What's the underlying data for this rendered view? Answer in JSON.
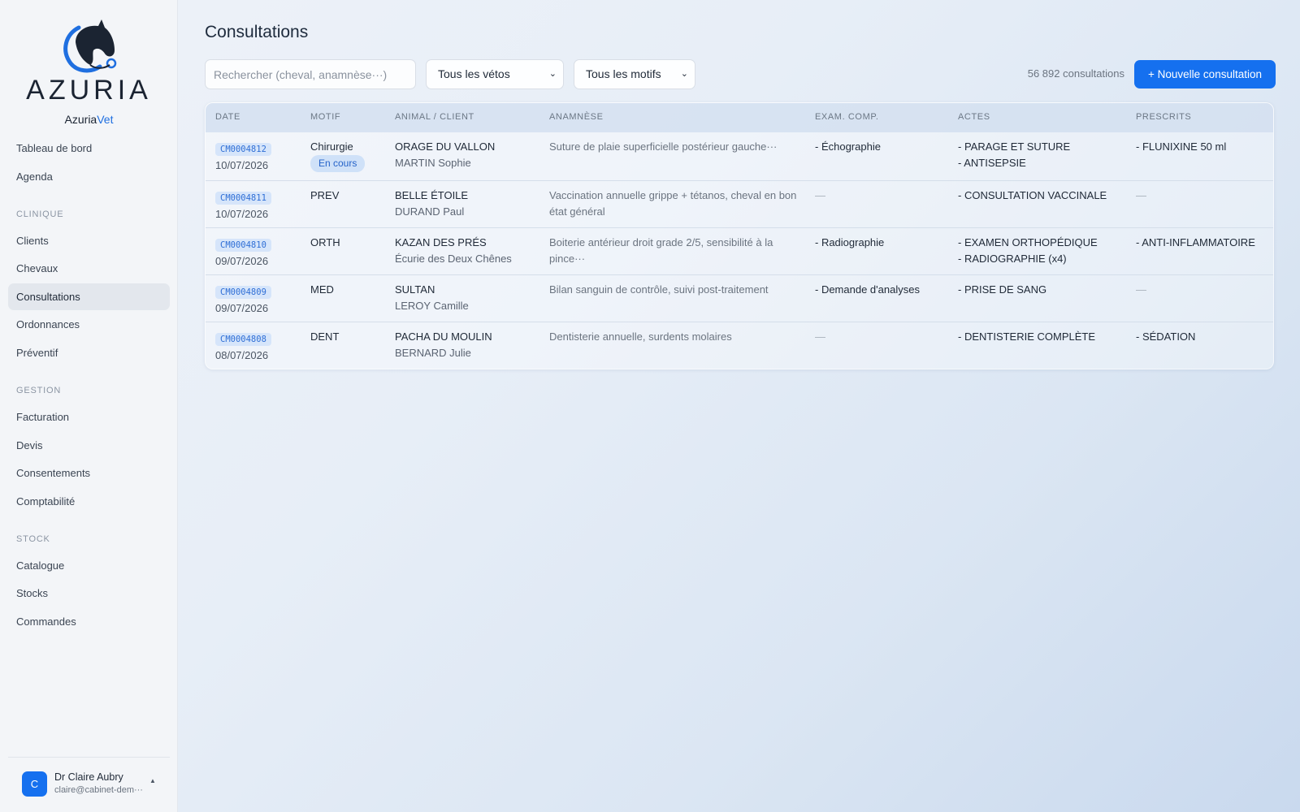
{
  "brand": {
    "wordmark": "AZURIA",
    "sub_main": "Azuria",
    "sub_accent": "Vet"
  },
  "nav": {
    "top": [
      "Tableau de bord",
      "Agenda"
    ],
    "sections": [
      {
        "title": "CLINIQUE",
        "items": [
          "Clients",
          "Chevaux",
          "Consultations",
          "Ordonnances",
          "Préventif"
        ]
      },
      {
        "title": "GESTION",
        "items": [
          "Facturation",
          "Devis",
          "Consentements",
          "Comptabilité"
        ]
      },
      {
        "title": "STOCK",
        "items": [
          "Catalogue",
          "Stocks",
          "Commandes"
        ]
      }
    ],
    "active": "Consultations"
  },
  "user": {
    "initial": "C",
    "name": "Dr Claire Aubry",
    "email": "claire@cabinet-dem···",
    "caret": "▲"
  },
  "page": {
    "title": "Consultations",
    "search_placeholder": "Rechercher (cheval, anamnèse···)",
    "vet_filter": "Tous les vétos",
    "motif_filter": "Tous les motifs",
    "count": "56 892 consultations",
    "new_button": "+ Nouvelle consultation"
  },
  "table": {
    "headers": [
      "DATE",
      "MOTIF",
      "ANIMAL / CLIENT",
      "ANAMNÈSE",
      "EXAM. COMP.",
      "ACTES",
      "PRESCRITS"
    ],
    "rows": [
      {
        "id": "CM0004812",
        "date": "10/07/2026",
        "motif": "Chirurgie",
        "status": "En cours",
        "animal": "ORAGE DU VALLON",
        "client": "MARTIN Sophie",
        "anamnese": "Suture de plaie superficielle postérieur gauche···",
        "exam": "- Échographie",
        "actes": [
          "- PARAGE ET SUTURE",
          "- ANTISEPSIE"
        ],
        "prescrits": "- FLUNIXINE 50 ml"
      },
      {
        "id": "CM0004811",
        "date": "10/07/2026",
        "motif": "PREV",
        "status": "",
        "animal": "BELLE ÉTOILE",
        "client": "DURAND Paul",
        "anamnese": "Vaccination annuelle grippe + tétanos, cheval en bon état général",
        "exam": "—",
        "actes": [
          "- CONSULTATION VACCINALE"
        ],
        "prescrits": "—"
      },
      {
        "id": "CM0004810",
        "date": "09/07/2026",
        "motif": "ORTH",
        "status": "",
        "animal": "KAZAN DES PRÉS",
        "client": "Écurie des Deux Chênes",
        "anamnese": "Boiterie antérieur droit grade 2/5, sensibilité à la pince···",
        "exam": "- Radiographie",
        "actes": [
          "- EXAMEN ORTHOPÉDIQUE",
          "- RADIOGRAPHIE (x4)"
        ],
        "prescrits": "- ANTI-INFLAMMATOIRE"
      },
      {
        "id": "CM0004809",
        "date": "09/07/2026",
        "motif": "MED",
        "status": "",
        "animal": "SULTAN",
        "client": "LEROY Camille",
        "anamnese": "Bilan sanguin de contrôle, suivi post-traitement",
        "exam": "- Demande d'analyses",
        "actes": [
          "- PRISE DE SANG"
        ],
        "prescrits": "—"
      },
      {
        "id": "CM0004808",
        "date": "08/07/2026",
        "motif": "DENT",
        "status": "",
        "animal": "PACHA DU MOULIN",
        "client": "BERNARD Julie",
        "anamnese": "Dentisterie annuelle, surdents molaires",
        "exam": "—",
        "actes": [
          "- DENTISTERIE COMPLÈTE"
        ],
        "prescrits": "- SÉDATION"
      }
    ]
  },
  "colors": {
    "accent": "#1570ef",
    "badge_bg": "#d6e5fa",
    "badge_text": "#2f6fd6"
  }
}
